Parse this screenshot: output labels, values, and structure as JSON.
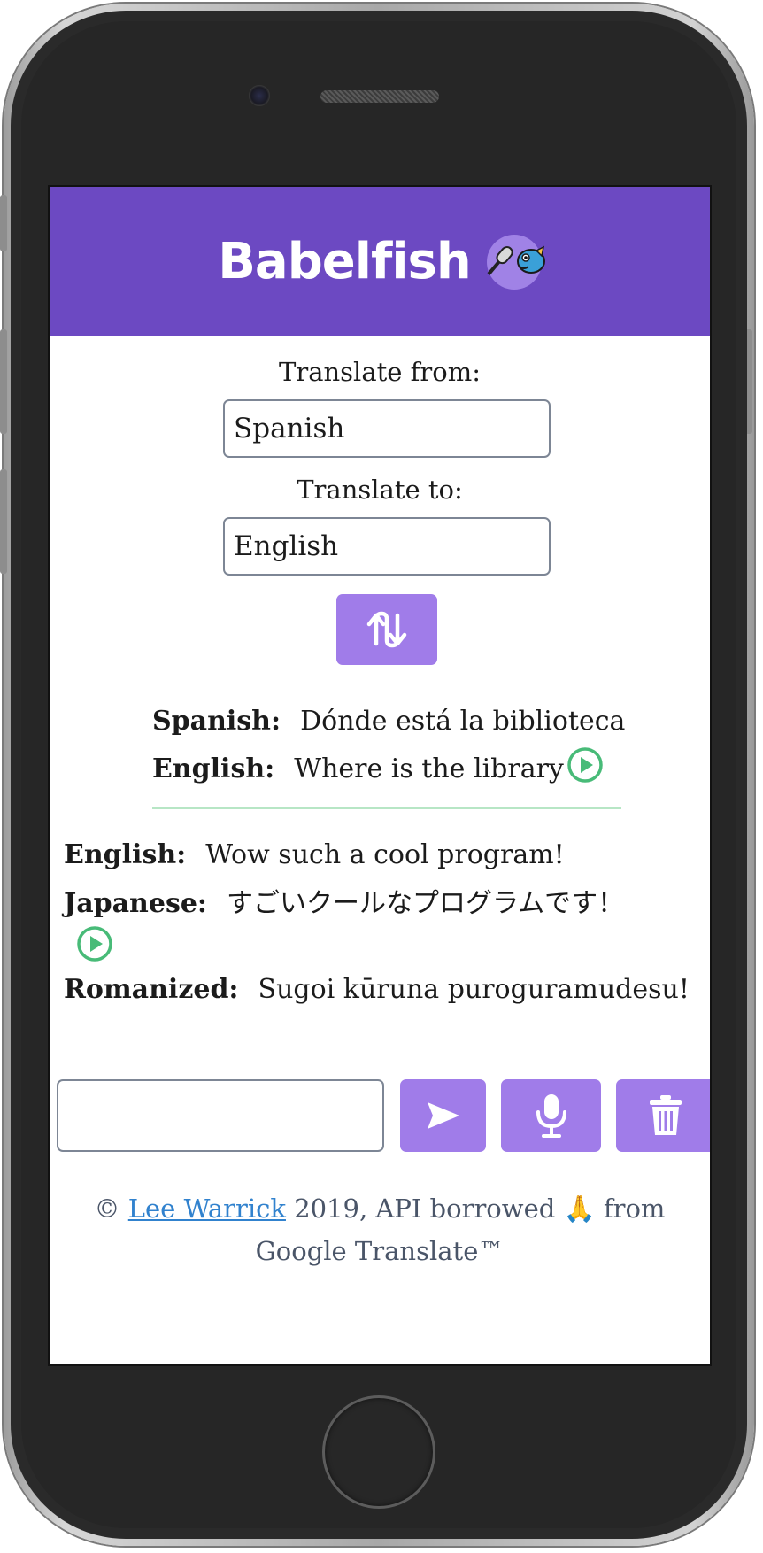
{
  "header": {
    "app_name": "Babelfish"
  },
  "languages": {
    "from_label": "Translate from:",
    "from_value": "Spanish",
    "to_label": "Translate to:",
    "to_value": "English"
  },
  "translations": [
    {
      "source_lang": "Spanish:",
      "source_text": "Dónde está la biblioteca",
      "target_lang": "English:",
      "target_text": "Where is the library"
    },
    {
      "source_lang": "English:",
      "source_text": "Wow such a cool program!",
      "target_lang": "Japanese:",
      "target_text": "すごいクールなプログラムです！",
      "romanized_label": "Romanized:",
      "romanized_text": "Sugoi kūruna puroguramudesu!"
    }
  ],
  "input": {
    "value": ""
  },
  "footer": {
    "copyright": "©",
    "author_link": "Lee Warrick",
    "text_mid": "2019, API borrowed",
    "emoji": "🙏",
    "text_from": "from",
    "text_end": "Google Translate™"
  },
  "colors": {
    "header_bg": "#6c49c2",
    "button_bg": "#a07ce9",
    "play_icon": "#48bb78",
    "divider": "#b7e6c5",
    "link": "#3182ce"
  }
}
